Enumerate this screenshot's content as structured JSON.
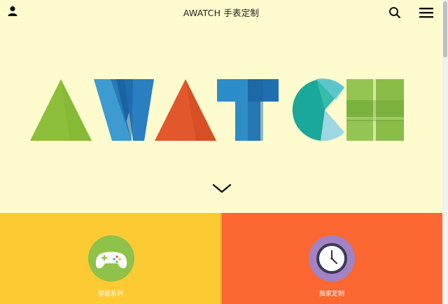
{
  "header": {
    "title": "AWATCH 手表定制",
    "user_icon": "user-icon",
    "search_icon": "search-icon",
    "menu_icon": "hamburger-menu-icon"
  },
  "hero": {
    "logo_text": "AWATCH",
    "scroll_icon": "chevron-down-icon"
  },
  "tiles": [
    {
      "label": "智能系列",
      "icon": "gamepad-icon",
      "background": "#fcca33",
      "icon_color": "#8fc24a"
    },
    {
      "label": "独家定制",
      "icon": "clock-icon",
      "background": "#fd6731",
      "icon_color": "#a283c3"
    }
  ],
  "colors": {
    "page_background": "#fefcce",
    "letter_a_green": "#8dbf3a",
    "letter_w_blue": "#2d8fc8",
    "letter_a_orange": "#e2582c",
    "letter_t_blue": "#2f8dc6",
    "letter_c_teal": "#1ab2a2",
    "letter_h_green": "#8dbf4c"
  }
}
